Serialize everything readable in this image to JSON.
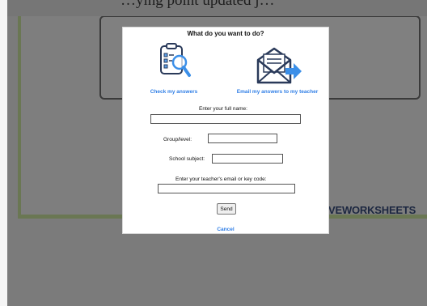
{
  "background": {
    "top_text": "…ying point updated j…",
    "brand_text": "VEWORKSHEETS"
  },
  "modal": {
    "title": "What do you want to do?",
    "options": {
      "check": {
        "label": "Check my answers",
        "icon": "clipboard-magnifier-icon"
      },
      "email": {
        "label": "Email my answers to my teacher",
        "icon": "envelope-arrow-icon"
      }
    },
    "fields": {
      "full_name": {
        "label": "Enter your full name:",
        "value": ""
      },
      "group_level": {
        "label": "Group/level:",
        "value": ""
      },
      "school_subject": {
        "label": "School subject:",
        "value": ""
      },
      "teacher_email": {
        "label": "Enter your teacher's email or key code:",
        "value": ""
      }
    },
    "send_label": "Send",
    "cancel_label": "Cancel"
  },
  "colors": {
    "link_blue": "#2f7ee6",
    "icon_navy": "#2a3a5a",
    "arrow_blue": "#3b8fe8",
    "overlay_gray": "#7b7b7b",
    "worksheet_green": "#6a7753"
  }
}
